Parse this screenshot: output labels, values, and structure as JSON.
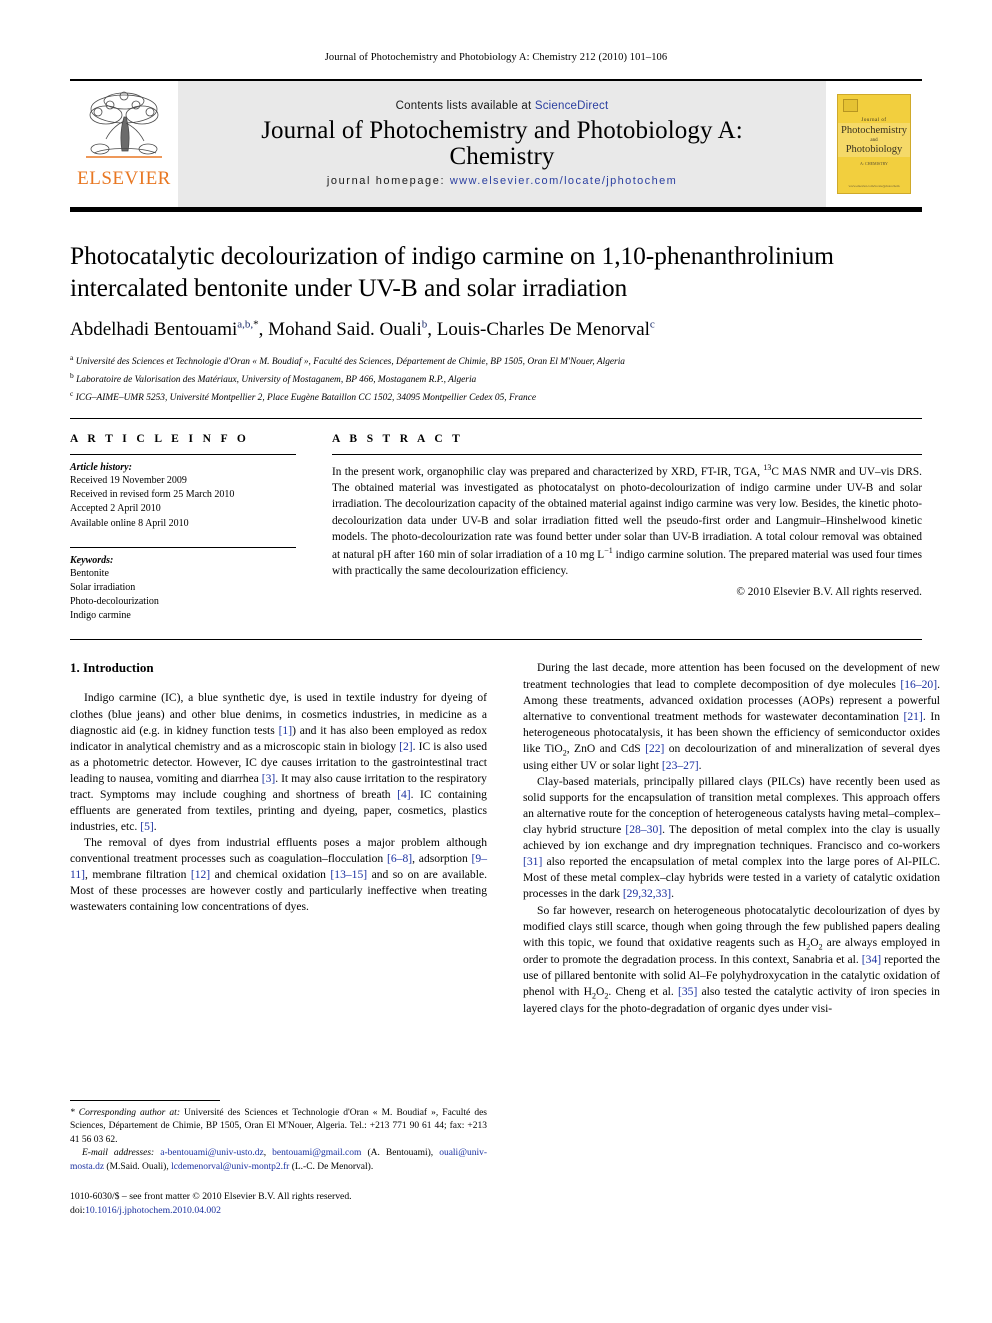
{
  "running_head": "Journal of Photochemistry and Photobiology A: Chemistry 212 (2010) 101–106",
  "masthead": {
    "contents_prefix": "Contents lists available at ",
    "sciencedirect": "ScienceDirect",
    "journal_title_line1": "Journal of Photochemistry and Photobiology A:",
    "journal_title_line2": "Chemistry",
    "homepage_label": "journal homepage:",
    "homepage_url": "www.elsevier.com/locate/jphotochem",
    "publisher_wordmark": "ELSEVIER",
    "cover": {
      "line1": "Journal of",
      "line2": "Photochemistry",
      "line3": "and",
      "line4": "Photobiology",
      "line5": "A: CHEMISTRY",
      "line6": "www.elsevier.com/locate/jphotochem"
    },
    "accent_orange": "#E87722",
    "link_blue": "#2b3fa0",
    "band_grey": "#e9e9e9",
    "cover_yellow": "#f2cf3e"
  },
  "article": {
    "title": "Photocatalytic decolourization of indigo carmine on 1,10-phenanthrolinium intercalated bentonite under UV-B and solar irradiation",
    "authors_html": "Abdelhadi Bentouami<sup>a,b,</sup><sup class=\"star\">*</sup>, Mohand Said. Ouali<sup>b</sup>, Louis-Charles De Menorval<sup>c</sup>",
    "affiliations": [
      "Université des Sciences et Technologie d'Oran « M. Boudiaf », Faculté des Sciences, Département de Chimie, BP 1505, Oran El M'Nouer, Algeria",
      "Laboratoire de Valorisation des Matériaux, University of Mostaganem, BP 466, Mostaganem R.P., Algeria",
      "ICG–AIME–UMR 5253, Université Montpellier 2, Place Eugène Bataillon CC 1502, 34095 Montpellier Cedex 05, France"
    ],
    "affiliation_marks": [
      "a",
      "b",
      "c"
    ]
  },
  "article_info": {
    "heading": "A R T I C L E     I N F O",
    "history_label": "Article history:",
    "history": [
      "Received 19 November 2009",
      "Received in revised form 25 March 2010",
      "Accepted 2 April 2010",
      "Available online 8 April 2010"
    ],
    "keywords_label": "Keywords:",
    "keywords": [
      "Bentonite",
      "Solar irradiation",
      "Photo-decolourization",
      "Indigo carmine"
    ]
  },
  "abstract": {
    "heading": "A B S T R A C T",
    "text_html": "In the present work, organophilic clay was prepared and characterized by XRD, FT-IR, TGA, <sup>13</sup>C MAS NMR and UV–vis DRS. The obtained material was investigated as photocatalyst on photo-decolourization of indigo carmine under UV-B and solar irradiation. The decolourization capacity of the obtained material against indigo carmine was very low. Besides, the kinetic photo-decolourization data under UV-B and solar irradiation fitted well the pseudo-first order and Langmuir–Hinshelwood kinetic models. The photo-decolourization rate was found better under solar than UV-B irradiation. A total colour removal was obtained at natural pH after 160 min of solar irradiation of a 10 mg L<sup>−1</sup> indigo carmine solution. The prepared material was used four times with practically the same decolourization efficiency.",
    "copyright": "© 2010 Elsevier B.V. All rights reserved."
  },
  "body": {
    "section_number_title": "1.  Introduction",
    "left_paragraphs_html": [
      "Indigo carmine (IC), a blue synthetic dye, is used in textile industry for dyeing of clothes (blue jeans) and other blue denims, in cosmetics industries, in medicine as a diagnostic aid (e.g. in kidney function tests <span class=\"ref\">[1]</span>) and it has also been employed as redox indicator in analytical chemistry and as a microscopic stain in biology <span class=\"ref\">[2]</span>. IC is also used as a photometric detector. However, IC dye causes irritation to the gastrointestinal tract leading to nausea, vomiting and diarrhea <span class=\"ref\">[3]</span>. It may also cause irritation to the respiratory tract. Symptoms may include coughing and shortness of breath <span class=\"ref\">[4]</span>. IC containing effluents are generated from textiles, printing and dyeing, paper, cosmetics, plastics industries, etc. <span class=\"ref\">[5]</span>.",
      "The removal of dyes from industrial effluents poses a major problem although conventional treatment processes such as coagulation–flocculation <span class=\"ref\">[6–8]</span>, adsorption <span class=\"ref\">[9–11]</span>, membrane filtration <span class=\"ref\">[12]</span> and chemical oxidation <span class=\"ref\">[13–15]</span> and so on are available. Most of these processes are however costly and particularly ineffective when treating wastewaters containing low concentrations of dyes."
    ],
    "right_paragraphs_html": [
      "During the last decade, more attention has been focused on the development of new treatment technologies that lead to complete decomposition of dye molecules <span class=\"ref\">[16–20]</span>. Among these treatments, advanced oxidation processes (AOPs) represent a powerful alternative to conventional treatment methods for wastewater decontamination <span class=\"ref\">[21]</span>. In heterogeneous photocatalysis, it has been shown the efficiency of semiconductor oxides like TiO<sub>2</sub>, ZnO and CdS <span class=\"ref\">[22]</span> on decolourization of and mineralization of several dyes using either UV or solar light <span class=\"ref\">[23–27]</span>.",
      "Clay-based materials, principally pillared clays (PILCs) have recently been used as solid supports for the encapsulation of transition metal complexes. This approach offers an alternative route for the conception of heterogeneous catalysts having metal–complex–clay hybrid structure <span class=\"ref\">[28–30]</span>. The deposition of metal complex into the clay is usually achieved by ion exchange and dry impregnation techniques. Francisco and co-workers <span class=\"ref\">[31]</span> also reported the encapsulation of metal complex into the large pores of Al-PILC. Most of these metal complex–clay hybrids were tested in a variety of catalytic oxidation processes in the dark <span class=\"ref\">[29,32,33]</span>.",
      "So far however, research on heterogeneous photocatalytic decolourization of dyes by modified clays still scarce, though when going through the few published papers dealing with this topic, we found that oxidative reagents such as H<sub>2</sub>O<sub>2</sub> are always employed in order to promote the degradation process. In this context, Sanabria et al. <span class=\"ref\">[34]</span> reported the use of pillared bentonite with solid Al–Fe polyhydroxycation in the catalytic oxidation of phenol with H<sub>2</sub>O<sub>2</sub>. Cheng et al. <span class=\"ref\">[35]</span> also tested the catalytic activity of iron species in layered clays for the photo-degradation of organic dyes under visi-"
    ]
  },
  "footnote": {
    "corresponding_html": "<span style=\"font-style:italic\">* Corresponding author at:</span> Université des Sciences et Technologie d'Oran « M. Boudiaf », Faculté des Sciences, Département de Chimie, BP 1505, Oran El M'Nouer, Algeria. Tel.: +213 771 90 61 44; fax: +213 41 56 03 62.",
    "emails_html": "<span class=\"ital\">E-mail addresses:</span> <span class=\"mail\">a-bentouami@univ-usto.dz</span>, <span class=\"mail\">bentouami@gmail.com</span> (A. Bentouami), <span class=\"mail\">ouali@univ-mosta.dz</span> (M.Said. Ouali), <span class=\"mail\">lcdemenorval@univ-montp2.fr</span> (L.-C. De Menorval).",
    "issn_html": "1010-6030/$ – see front matter © 2010 Elsevier B.V. All rights reserved.<br>doi:<span class=\"doi\">10.1016/j.jphotochem.2010.04.002</span>"
  }
}
